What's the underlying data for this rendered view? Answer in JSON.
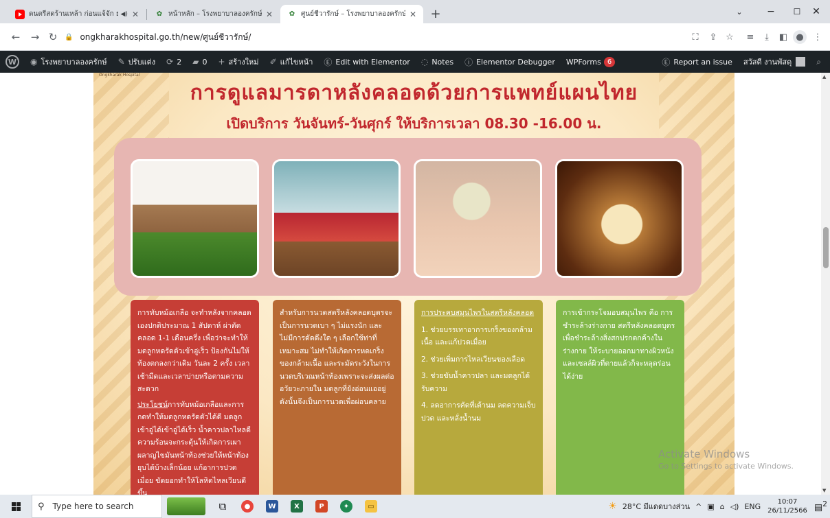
{
  "browser": {
    "tabs": [
      {
        "title": "ดนตรีสดร้านเหล้า ก่อนแจ้จัก ยุคอิ",
        "favicon": "youtube-icon",
        "has_sound": true
      },
      {
        "title": "หน้าหลัก – โรงพยาบาลองครักษ์",
        "favicon": "hospital-icon"
      },
      {
        "title": "ศูนย์ชีวารักษ์ – โรงพยาบาลองครักษ์",
        "favicon": "hospital-icon",
        "active": true
      }
    ],
    "url": "ongkharakhospital.go.th/new/ศูนย์ชีวารักษ์/"
  },
  "wpbar": {
    "site_name": "โรงพยาบาลองครักษ์",
    "customize": "ปรับแต่ง",
    "updates_count": "2",
    "comments_count": "0",
    "new_label": "สร้างใหม่",
    "edit_page": "แก้ไขหน้า",
    "elementor_edit": "Edit with Elementor",
    "notes": "Notes",
    "debugger": "Elementor Debugger",
    "wpforms": "WPForms",
    "wpforms_badge": "6",
    "report": "Report an issue",
    "greeting": "สวัสดี งานพัสดุ"
  },
  "poster": {
    "logo_text": "Ongkharak Hospital",
    "title": "การดูแลมารดาหลังคลอดด้วยการแพทย์แผนไทย",
    "subtitle": "เปิดบริการ วันจันทร์-วันศุกร์ ให้บริการเวลา 08.30 -16.00 น.",
    "columns": [
      {
        "paragraphs": [
          "การทับหม้อเกลือ จะทำหลังจากคลอดเองปกติประมาณ 1 สัปดาห์ ผ่าตัดคลอด 1-1 เดือนครึ่ง เพื่อว่าจะทำให้มดลูกหดรัดตัวเข้าอู่เร็ว ป้องกันไม่ให้ท้องตกลงกว่าเดิม วันละ 2 ครั้ง เวลาเช้ามืดและเวลาบ่ายหรือตามความสะดวก"
        ],
        "benefit_label": "ประโยชน์",
        "benefit_text": "การทับหม้อเกลือและการกดทำให้มดลูกหดรัดตัวได้ดี มดลูกเข้าอู่ได้เข้าอู่ได้เร็ว น้ำคาวปลาไหลดี ความร้อนจะกระตุ้นให้เกิดการเผาผลาญไขมันหน้าท้องช่วยให้หน้าท้องยุบได้บ้างเล็กน้อย แก้อาการปวดเมื่อย ขัดยอกทำให้โลหิตไหลเวียนดีขึ้น"
      },
      {
        "paragraphs": [
          "สำหรับการนวดสตรีหลังคลอดบุตรจะเป็นการนวดเบา ๆ ไม่แรงนัก และไม่มีการดัดดึงใด ๆ เลือกใช้ท่าที่เหมาะสม ไม่ทำให้เกิดการหดเกร็งของกล้ามเนื้อ และระมัดระวังในการนวดบริเวณหน้าท้องเพราะจะส่งผลต่ออวัยวะภายใน มดลูกที่ยังอ่อนแออยู่ ดังนั้นจึงเป็นการนวดเพื่อผ่อนคลาย"
        ]
      },
      {
        "heading": "การประคบสมุนไพรในสตรีหลังคลอด",
        "items": [
          "1. ช่วยบรรเทาอาการเกร็งของกล้ามเนื้อ และแก้ปวดเมื่อย",
          "2. ช่วยเพิ่มการไหลเวียนของเลือด",
          "3. ช่วยขับน้ำคาวปลา และมดลูกได้รับความ",
          "4. ลดอาการคัดที่เต้านม ลดความเจ็บปวด และหลั่งน้ำนม"
        ]
      },
      {
        "paragraphs": [
          "การเข้ากระโจมอบสมุนไพร คือ การชำระล้างร่างกาย สตรีหลังคลอดบุตรเพื่อชำระล้างสิ่งสกปรกตกค้างในร่างกาย ให้ระบายออกมาทางผิวหนัง และเซลล์ผิวที่ตายแล้วก็จะหลุดร่อนได้ง่าย"
        ]
      }
    ]
  },
  "watermark": {
    "line1": "Activate Windows",
    "line2": "Go to Settings to activate Windows."
  },
  "taskbar": {
    "search_placeholder": "Type here to search",
    "weather": "28°C มีแดดบางส่วน",
    "lang": "ENG",
    "time": "10:07",
    "date": "26/11/2566",
    "notif_count": "2"
  },
  "colors": {
    "accent_red": "#c1272d",
    "col1": "#c63e36",
    "col2": "#b86a34",
    "col3": "#b7a93d",
    "col4": "#82b84a"
  }
}
